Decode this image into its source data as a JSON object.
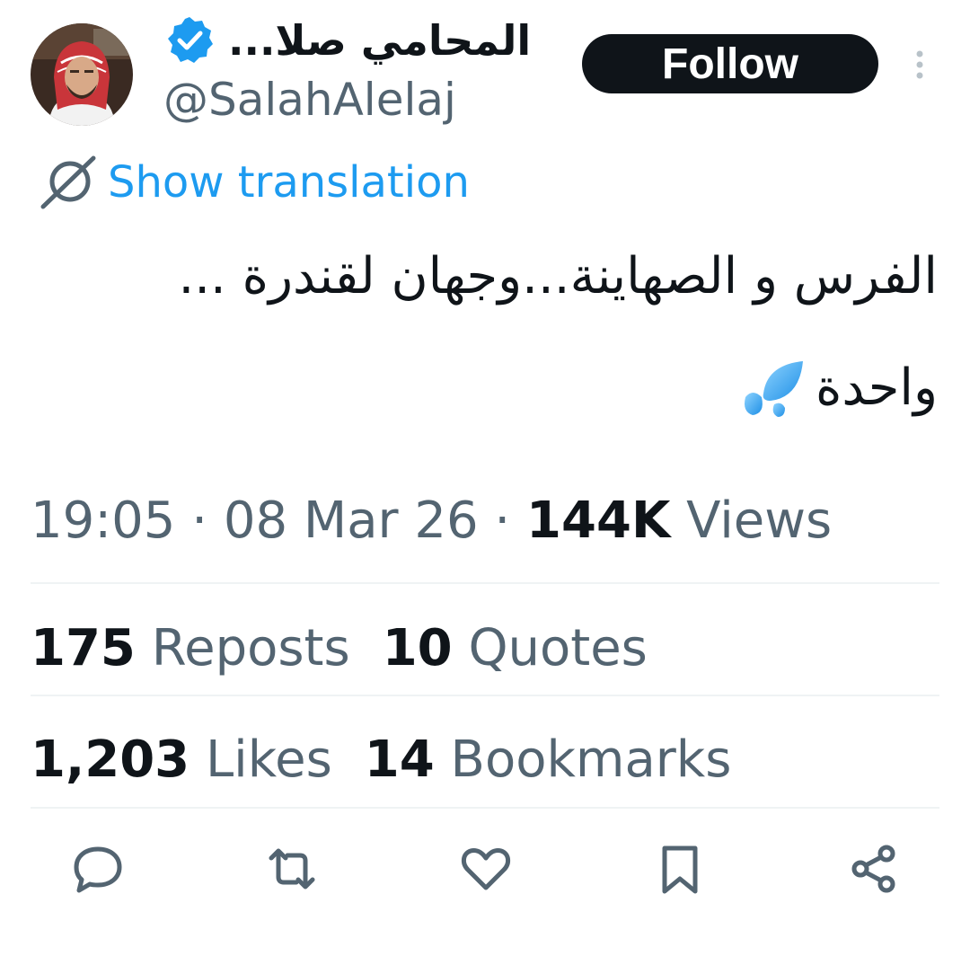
{
  "author": {
    "display_name": "المحامي صلا...",
    "handle": "@SalahAlelaj",
    "verified": true
  },
  "follow_button": {
    "label": "Follow"
  },
  "translation": {
    "label": "Show translation",
    "icon": "globe-slash-icon"
  },
  "tweet": {
    "line1": "الفرس و الصهاينة...وجهان لقندرة ...",
    "line2": "واحدة",
    "emoji": "droplets-icon"
  },
  "meta": {
    "time": "19:05",
    "separator1": "·",
    "date": "08 Mar 26",
    "separator2": "·",
    "views_count": "144K",
    "views_label": "Views"
  },
  "stats": {
    "reposts_count": "175",
    "reposts_label": "Reposts",
    "quotes_count": "10",
    "quotes_label": "Quotes",
    "likes_count": "1,203",
    "likes_label": "Likes",
    "bookmarks_count": "14",
    "bookmarks_label": "Bookmarks"
  },
  "actions": [
    "reply-icon",
    "repost-icon",
    "like-icon",
    "bookmark-icon",
    "share-icon"
  ],
  "colors": {
    "text_primary": "#0f1419",
    "text_secondary": "#536471",
    "accent": "#1d9bf0",
    "divider": "#eff3f4"
  }
}
